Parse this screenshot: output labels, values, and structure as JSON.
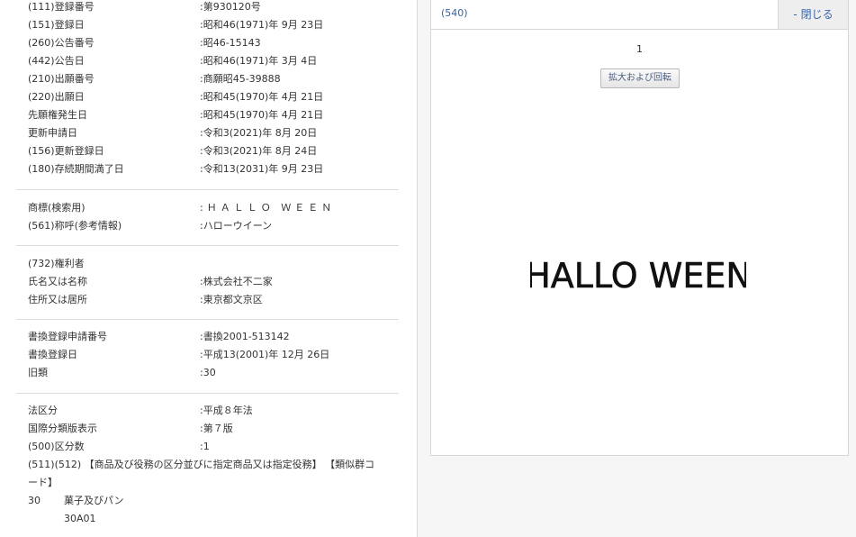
{
  "registration": [
    {
      "label": "(111)登録番号",
      "value": ":第930120号"
    },
    {
      "label": "(151)登録日",
      "value": ":昭和46(1971)年 9月 23日"
    },
    {
      "label": "(260)公告番号",
      "value": ":昭46-15143"
    },
    {
      "label": "(442)公告日",
      "value": ":昭和46(1971)年 3月 4日"
    },
    {
      "label": "(210)出願番号",
      "value": ":商願昭45-39888"
    },
    {
      "label": "(220)出願日",
      "value": ":昭和45(1970)年 4月 21日"
    },
    {
      "label": "先願権発生日",
      "value": ":昭和45(1970)年 4月 21日"
    },
    {
      "label": "更新申請日",
      "value": ":令和3(2021)年 8月 20日"
    },
    {
      "label": "(156)更新登録日",
      "value": ":令和3(2021)年 8月 24日"
    },
    {
      "label": "(180)存続期間満了日",
      "value": ":令和13(2031)年 9月 23日"
    }
  ],
  "trademark": [
    {
      "label": "商標(検索用)",
      "value": ":ＨＡＬＬＯ ＷＥＥＮ"
    },
    {
      "label": "(561)称呼(参考情報)",
      "value": ":ハローウイーン"
    }
  ],
  "holder": {
    "heading": "(732)権利者",
    "rows": [
      {
        "label": "氏名又は名称",
        "value": ":株式会社不二家"
      },
      {
        "label": "住所又は居所",
        "value": ":東京都文京区"
      }
    ]
  },
  "rewrite": [
    {
      "label": "書換登録申請番号",
      "value": ":書換2001-513142"
    },
    {
      "label": "書換登録日",
      "value": ":平成13(2001)年 12月 26日"
    },
    {
      "label": "旧類",
      "value": ":30"
    }
  ],
  "classification": [
    {
      "label": "法区分",
      "value": ":平成８年法"
    },
    {
      "label": "国際分類版表示",
      "value": ":第７版"
    },
    {
      "label": "(500)区分数",
      "value": ":1"
    }
  ],
  "goods": {
    "heading_line1": "(511)(512) 【商品及び役務の区分並びに指定商品又は指定役務】 【類似群コ",
    "heading_line2": "ード】",
    "class": "30",
    "item": "菓子及びパン",
    "code": "30A01"
  },
  "image_panel": {
    "code": "(540)",
    "close_label": "- 閉じる",
    "page_number": "1",
    "rotate_label": "拡大および回転",
    "mark_text": "HALLO WEEN"
  }
}
